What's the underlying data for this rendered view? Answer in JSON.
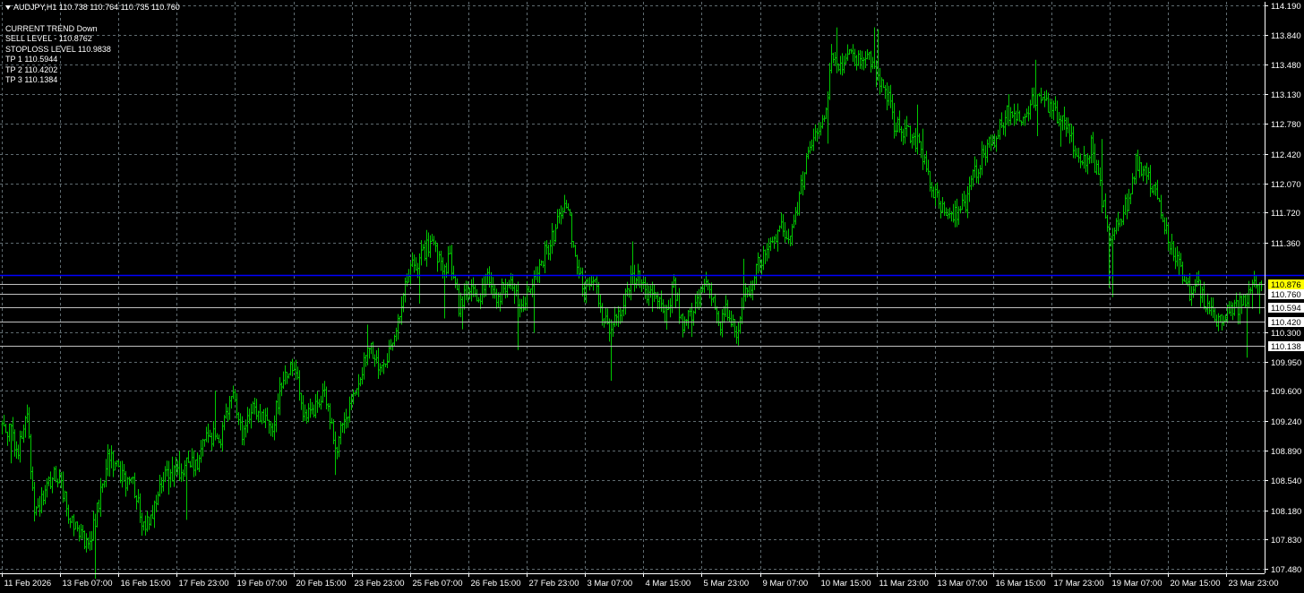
{
  "header": {
    "symbol_line": "AUDJPY,H1  110.738 110.764 110.735 110.760"
  },
  "overlay": {
    "lines": [
      "CURRENT TREND  Down",
      "SELL LEVEL - 110.8762",
      "STOPLOSS LEVEL 110.9838",
      "TP 1 110.5944",
      "TP 2 110.4202",
      "TP 3 110.1384"
    ]
  },
  "colors": {
    "background": "#000000",
    "grid": "#5f6b70",
    "candle": "#00c800",
    "axis_text": "#ffffff",
    "stoploss_line": "#0000ff",
    "sell_label_bg": "#ffff00",
    "level_line": "#c0c0c0"
  },
  "chart_data": {
    "type": "line",
    "symbol": "AUDJPY",
    "timeframe": "H1",
    "ohlc_current": {
      "open": 110.738,
      "high": 110.764,
      "low": 110.735,
      "close": 110.76
    },
    "ylim": [
      107.43,
      114.23
    ],
    "y_ticks": [
      "114.190",
      "113.840",
      "113.480",
      "113.130",
      "112.780",
      "112.420",
      "112.070",
      "111.720",
      "111.360",
      "110.300",
      "109.950",
      "109.600",
      "109.240",
      "108.890",
      "108.540",
      "108.180",
      "107.830",
      "107.480"
    ],
    "x_ticks": [
      "11 Feb 2026",
      "13 Feb 07:00",
      "16 Feb 15:00",
      "17 Feb 23:00",
      "19 Feb 07:00",
      "20 Feb 15:00",
      "23 Feb 23:00",
      "25 Feb 07:00",
      "26 Feb 15:00",
      "27 Feb 23:00",
      "3 Mar 07:00",
      "4 Mar 15:00",
      "5 Mar 23:00",
      "9 Mar 07:00",
      "10 Mar 15:00",
      "11 Mar 23:00",
      "13 Mar 07:00",
      "16 Mar 15:00",
      "17 Mar 23:00",
      "19 Mar 07:00",
      "20 Mar 15:00",
      "23 Mar 23:00"
    ],
    "grid": true,
    "levels": [
      {
        "label": "110.876",
        "value": 110.876,
        "kind": "sell"
      },
      {
        "label": "110.760",
        "value": 110.76,
        "kind": "current"
      },
      {
        "label": "110.594",
        "value": 110.594,
        "kind": "tp"
      },
      {
        "label": "110.420",
        "value": 110.42,
        "kind": "tp"
      },
      {
        "label": "110.138",
        "value": 110.138,
        "kind": "tp"
      }
    ],
    "stoploss_level": 110.9838,
    "price_path": [
      [
        0,
        109.2
      ],
      [
        10,
        109.15
      ],
      [
        20,
        108.9
      ],
      [
        30,
        109.3
      ],
      [
        38,
        108.2
      ],
      [
        48,
        108.3
      ],
      [
        58,
        108.6
      ],
      [
        68,
        108.5
      ],
      [
        78,
        108.1
      ],
      [
        90,
        107.9
      ],
      [
        100,
        107.75
      ],
      [
        110,
        108.3
      ],
      [
        122,
        108.85
      ],
      [
        135,
        108.55
      ],
      [
        148,
        108.5
      ],
      [
        160,
        108.0
      ],
      [
        172,
        108.2
      ],
      [
        185,
        108.6
      ],
      [
        195,
        108.65
      ],
      [
        210,
        108.7
      ],
      [
        222,
        108.8
      ],
      [
        232,
        109.1
      ],
      [
        245,
        109.0
      ],
      [
        258,
        109.6
      ],
      [
        270,
        109.1
      ],
      [
        282,
        109.35
      ],
      [
        292,
        109.3
      ],
      [
        305,
        109.2
      ],
      [
        315,
        109.8
      ],
      [
        330,
        109.9
      ],
      [
        340,
        109.25
      ],
      [
        352,
        109.4
      ],
      [
        362,
        109.55
      ],
      [
        375,
        108.95
      ],
      [
        388,
        109.3
      ],
      [
        400,
        109.7
      ],
      [
        410,
        110.2
      ],
      [
        420,
        109.9
      ],
      [
        432,
        110.0
      ],
      [
        442,
        110.35
      ],
      [
        452,
        110.9
      ],
      [
        462,
        111.1
      ],
      [
        472,
        111.25
      ],
      [
        482,
        111.35
      ],
      [
        492,
        111.05
      ],
      [
        502,
        111.15
      ],
      [
        512,
        110.6
      ],
      [
        522,
        110.9
      ],
      [
        532,
        110.65
      ],
      [
        545,
        111.0
      ],
      [
        556,
        110.7
      ],
      [
        568,
        110.95
      ],
      [
        580,
        110.55
      ],
      [
        592,
        110.8
      ],
      [
        602,
        111.1
      ],
      [
        612,
        111.3
      ],
      [
        622,
        111.6
      ],
      [
        632,
        111.85
      ],
      [
        642,
        111.2
      ],
      [
        652,
        110.8
      ],
      [
        662,
        110.95
      ],
      [
        672,
        110.5
      ],
      [
        682,
        110.3
      ],
      [
        692,
        110.6
      ],
      [
        702,
        110.9
      ],
      [
        712,
        110.95
      ],
      [
        722,
        110.7
      ],
      [
        732,
        110.8
      ],
      [
        742,
        110.45
      ],
      [
        752,
        110.9
      ],
      [
        762,
        110.3
      ],
      [
        772,
        110.55
      ],
      [
        782,
        110.75
      ],
      [
        792,
        110.85
      ],
      [
        802,
        110.4
      ],
      [
        812,
        110.55
      ],
      [
        822,
        110.3
      ],
      [
        832,
        110.75
      ],
      [
        842,
        111.0
      ],
      [
        852,
        111.2
      ],
      [
        862,
        111.45
      ],
      [
        872,
        111.5
      ],
      [
        882,
        111.35
      ],
      [
        892,
        111.9
      ],
      [
        902,
        112.5
      ],
      [
        912,
        112.7
      ],
      [
        920,
        112.8
      ],
      [
        928,
        113.5
      ],
      [
        938,
        113.4
      ],
      [
        948,
        113.7
      ],
      [
        958,
        113.55
      ],
      [
        968,
        113.6
      ],
      [
        978,
        113.35
      ],
      [
        988,
        113.2
      ],
      [
        998,
        112.8
      ],
      [
        1008,
        112.7
      ],
      [
        1018,
        112.65
      ],
      [
        1028,
        112.5
      ],
      [
        1038,
        112.1
      ],
      [
        1048,
        111.8
      ],
      [
        1058,
        111.6
      ],
      [
        1068,
        111.7
      ],
      [
        1078,
        111.8
      ],
      [
        1088,
        112.2
      ],
      [
        1098,
        112.45
      ],
      [
        1108,
        112.55
      ],
      [
        1118,
        112.8
      ],
      [
        1128,
        112.95
      ],
      [
        1138,
        112.85
      ],
      [
        1148,
        113.0
      ],
      [
        1158,
        113.05
      ],
      [
        1168,
        113.0
      ],
      [
        1178,
        112.9
      ],
      [
        1188,
        112.85
      ],
      [
        1198,
        112.5
      ],
      [
        1208,
        112.3
      ],
      [
        1218,
        112.5
      ],
      [
        1228,
        112.0
      ],
      [
        1238,
        111.4
      ],
      [
        1248,
        111.6
      ],
      [
        1258,
        111.85
      ],
      [
        1268,
        112.3
      ],
      [
        1278,
        112.25
      ],
      [
        1288,
        111.95
      ],
      [
        1298,
        111.7
      ],
      [
        1308,
        111.3
      ],
      [
        1318,
        111.0
      ],
      [
        1328,
        110.75
      ],
      [
        1338,
        110.85
      ],
      [
        1348,
        110.6
      ],
      [
        1358,
        110.45
      ],
      [
        1368,
        110.5
      ],
      [
        1378,
        110.55
      ],
      [
        1388,
        110.65
      ],
      [
        1398,
        110.9
      ],
      [
        1408,
        110.76
      ]
    ]
  }
}
